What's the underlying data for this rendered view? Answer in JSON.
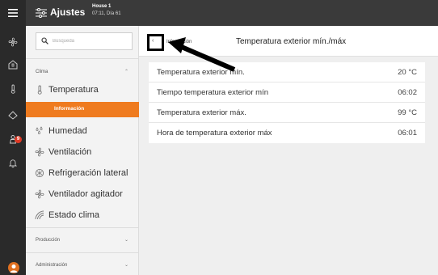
{
  "topbar": {
    "title": "Ajustes",
    "house": "House 1",
    "time": "07:11, Día 61"
  },
  "search": {
    "placeholder": "Búsqueda",
    "value": ""
  },
  "sidebar": {
    "sections": {
      "clima": "Clima",
      "produccion": "Producción",
      "administracion": "Administración"
    },
    "items": [
      {
        "label": "Temperatura",
        "icon": "thermometer-icon"
      },
      {
        "label": "Humedad",
        "icon": "humidity-icon"
      },
      {
        "label": "Ventilación",
        "icon": "fan-icon"
      },
      {
        "label": "Refrigeración lateral",
        "icon": "cooling-icon"
      },
      {
        "label": "Ventilador agitador",
        "icon": "fan-icon"
      },
      {
        "label": "Estado clima",
        "icon": "climate-status-icon"
      }
    ],
    "active_sub": "Información"
  },
  "rail": {
    "badge_count": "9"
  },
  "main": {
    "back_label": "Información",
    "title": "Temperatura exterior mín./máx",
    "rows": [
      {
        "label": "Temperatura exterior mín.",
        "value": "20 °C"
      },
      {
        "label": "Tiempo temperatura exterior mín",
        "value": "06:02"
      },
      {
        "label": "Temperatura exterior máx.",
        "value": "99 °C"
      },
      {
        "label": "Hora de temperatura exterior máx",
        "value": "06:01"
      }
    ]
  },
  "colors": {
    "accent": "#ef7b1f",
    "topbar": "#3a3a3a",
    "rail": "#2a2a2a",
    "badge": "#e03a26"
  }
}
